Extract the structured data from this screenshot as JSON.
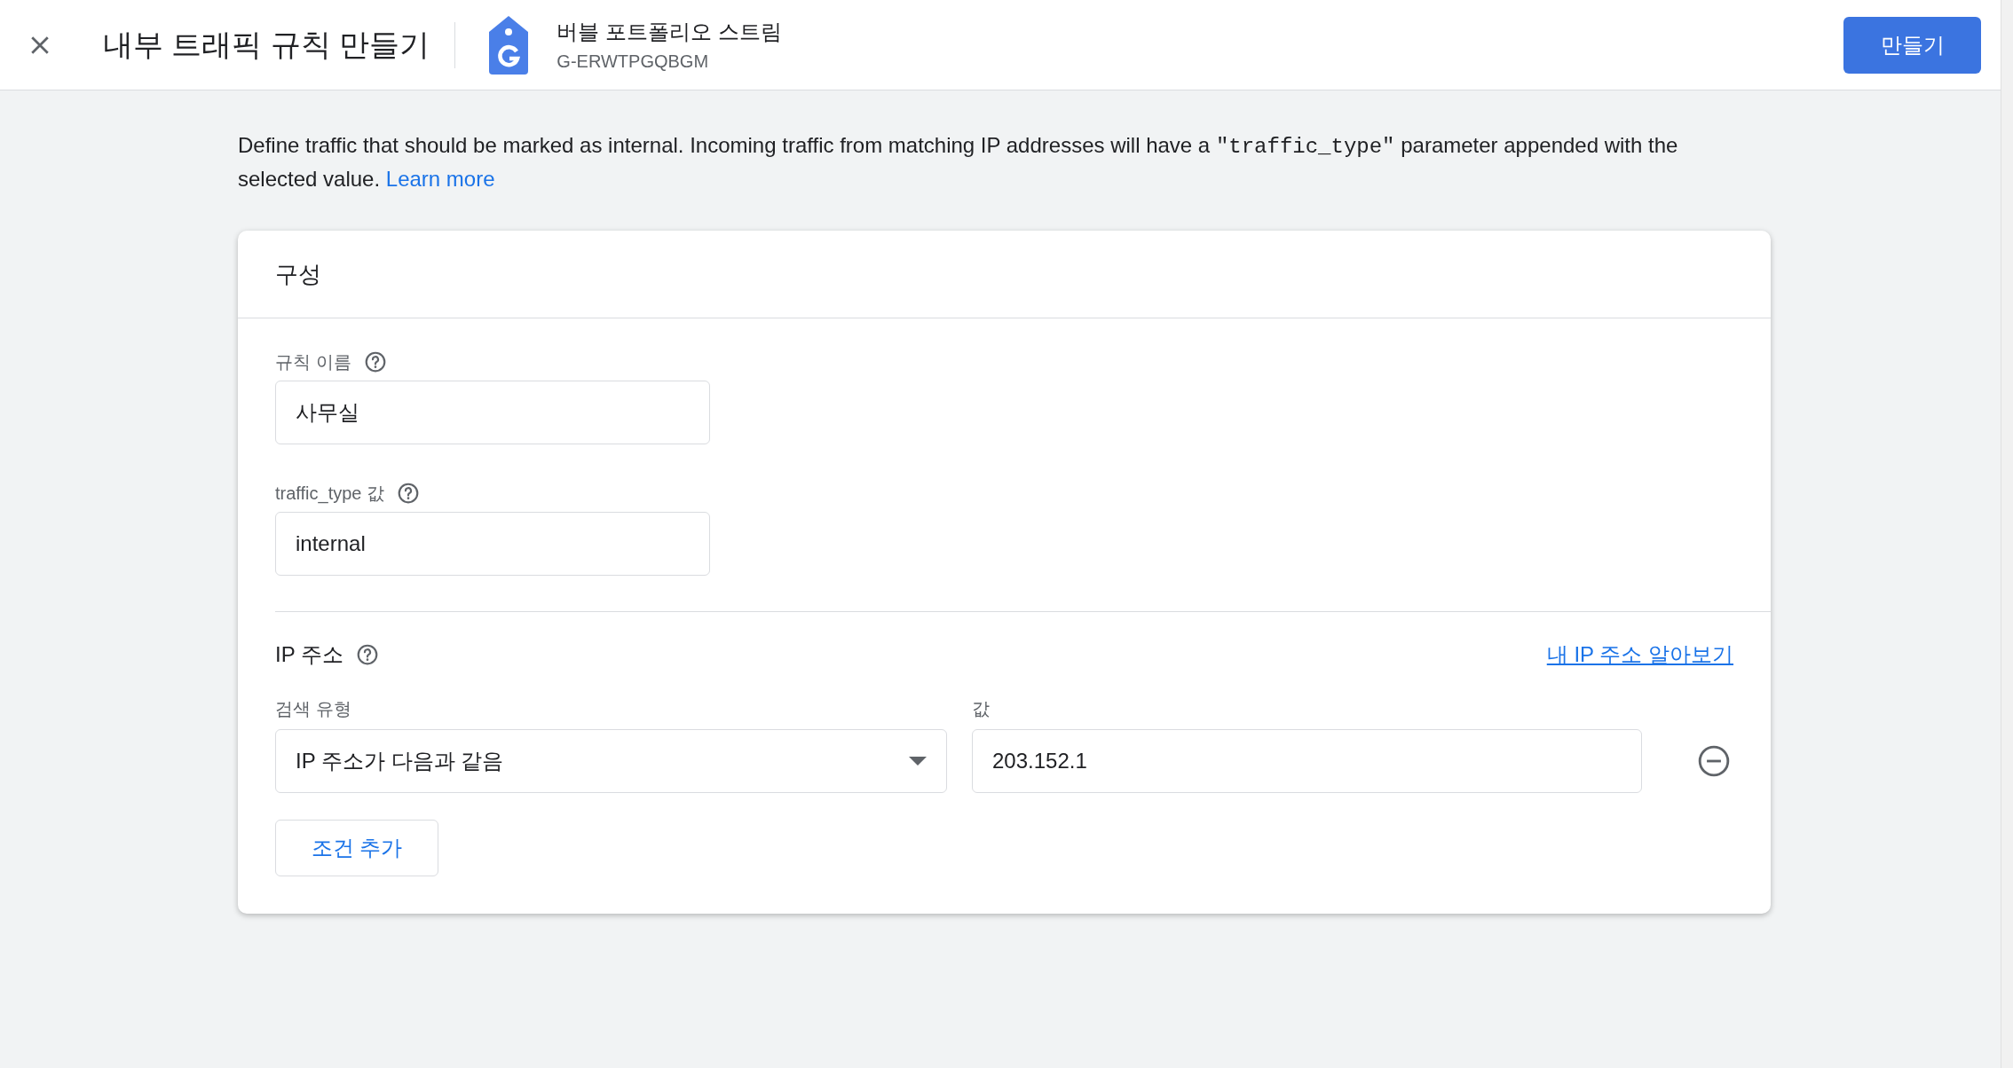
{
  "header": {
    "title": "내부 트래픽 규칙 만들기",
    "stream_name": "버블 포트폴리오 스트림",
    "stream_id": "G-ERWTPGQBGM",
    "create_button": "만들기"
  },
  "description": {
    "text_before": "Define traffic that should be marked as internal. Incoming traffic from matching IP addresses will have a ",
    "code": "\"traffic_type\"",
    "text_after": " parameter appended with the selected value. ",
    "link": "Learn more"
  },
  "card": {
    "title": "구성",
    "fields": [
      {
        "label": "규칙 이름",
        "value": "사무실"
      },
      {
        "label": "traffic_type 값",
        "value": "internal"
      }
    ],
    "ip_section": {
      "title": "IP 주소",
      "lookup_link": "내 IP 주소 알아보기",
      "match_type_label": "검색 유형",
      "value_label": "값",
      "conditions": [
        {
          "match_type": "IP 주소가 다음과 같음",
          "value": "203.152.1"
        }
      ],
      "add_button": "조건 추가"
    }
  }
}
